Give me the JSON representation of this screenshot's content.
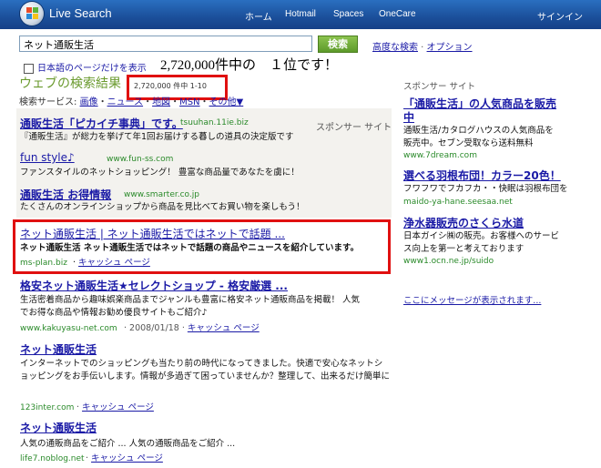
{
  "header": {
    "brand": "Live Search",
    "nav": [
      "ホーム",
      "Hotmail",
      "Spaces",
      "OneCare"
    ],
    "signin": "サインイン"
  },
  "search": {
    "query": "ネット通販生活",
    "button": "検索",
    "advanced": "高度な検索",
    "options": "オプション",
    "japanese_only": "日本語のページだけを表示"
  },
  "annotation": "2,720,000件中の　１位です！",
  "results_header": {
    "title": "ウェブの検索結果",
    "count": "2,720,000 件中 1-10",
    "services_label": "検索サービス:",
    "services": [
      "画像",
      "ニュース",
      "地図",
      "MSN",
      "その他▼"
    ]
  },
  "sponsored": {
    "label": "スポンサー サイト",
    "items": [
      {
        "title": "通販生活「ピカイチ事典」です。",
        "url": "tsuuhan.11ie.biz",
        "desc": "『通販生活』が総力を挙げて年1回お届けする暮しの道具の決定版です"
      },
      {
        "title": "fun style♪",
        "url": "www.fun-ss.com",
        "desc": "ファンスタイルのネットショッピング！ 豊富な商品量であなたを虜に！"
      },
      {
        "title": "通販生活 お得情報",
        "url": "www.smarter.co.jp",
        "desc": "たくさんのオンラインショップから商品を見比べてお買い物を楽しもう！"
      }
    ]
  },
  "results": [
    {
      "title": "ネット通販生活 | ネット通販生活ではネットで話題 ...",
      "desc": "ネット通販生活 ネット通販生活ではネットで話題の商品やニュースを紹介しています。",
      "url": "ms-plan.biz",
      "date": "",
      "cache": "キャッシュ ページ"
    },
    {
      "title": "格安ネット通販生活★セレクトショップ - 格安厳選 ...",
      "desc1": "生活密着商品から趣味娯楽商品までジャンルも豊富に格安ネット通販商品を掲載！ 人気",
      "desc2": "でお得な商品や情報お勧め優良サイトもご紹介♪",
      "url": "www.kakuyasu-net.com",
      "date": "2008/01/18",
      "cache": "キャッシュ ページ"
    },
    {
      "title": "ネット通販生活",
      "desc1": "インターネットでのショッピングも当たり前の時代になってきました。快適で安心なネットシ",
      "desc2": "ョッピングをお手伝いします。情報が多過ぎて困っていませんか？整理して、出来るだけ簡単に",
      "url": "123inter.com",
      "date": "",
      "cache": "キャッシュ ページ"
    },
    {
      "title": "ネット通販生活",
      "desc1": "人気の通販商品をご紹介 ... 人気の通販商品をご紹介 ...",
      "url": "life7.noblog.net",
      "date": "",
      "cache": "キャッシュ ページ"
    }
  ],
  "right": {
    "label": "スポンサー サイト",
    "items": [
      {
        "title1": "「通販生活」の人気商品を販売",
        "title2": "中",
        "desc1": "通販生活/カタログハウスの人気商品を",
        "desc2": "販売中。セブン受取なら送料無料",
        "url": "www.7dream.com"
      },
      {
        "title1": "選べる羽根布団！カラー20色！",
        "desc1": "フワフワでフカフカ・・快眠は羽根布団を",
        "url": "maido-ya-hane.seesaa.net"
      },
      {
        "title1": "浄水器販売のさくら水道",
        "desc1": "日本ガイシ㈱の販売。お客様へのサービ",
        "desc2": "ス向上を第一と考えております",
        "url": "www1.ocn.ne.jp/suido"
      }
    ],
    "message_link": "ここにメッセージが表示されます..."
  },
  "colors": {
    "header_bg": "#1b4f9a",
    "link": "#1a1aa6",
    "url_green": "#2a8a2a",
    "highlight_red": "#e01010",
    "section_green": "#6a9a2e",
    "sponsor_bg": "#f3f2ee"
  }
}
